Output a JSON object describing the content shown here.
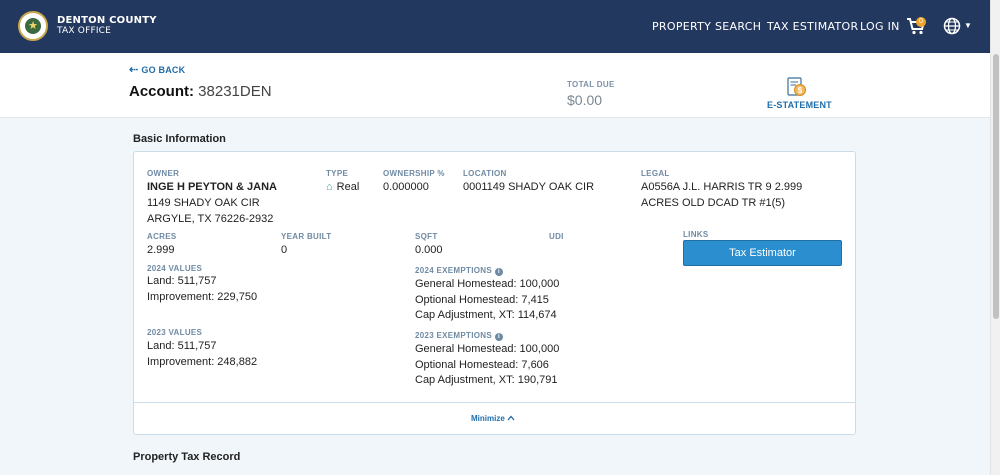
{
  "nav": {
    "brand_line1": "DENTON COUNTY",
    "brand_line2": "TAX OFFICE",
    "links": [
      "PROPERTY SEARCH",
      "TAX ESTIMATOR",
      "LOG IN"
    ],
    "cart_count": "0",
    "cart_icon": "cart-icon",
    "globe_icon": "globe-icon",
    "color": "#23385f"
  },
  "account": {
    "go_back": "GO BACK",
    "label": "Account:",
    "number": "38231DEN",
    "total_due_label": "TOTAL DUE",
    "total_due_value": "$0.00",
    "estatement_label": "E-STATEMENT"
  },
  "basic": {
    "title": "Basic Information",
    "owner_label": "OWNER",
    "owner_name": "INGE H PEYTON & JANA",
    "owner_addr1": "1149 SHADY OAK CIR",
    "owner_addr2": "ARGYLE, TX 76226-2932",
    "type_label": "TYPE",
    "type_value": "Real",
    "ownership_label": "OWNERSHIP %",
    "ownership_value": "0.000000",
    "location_label": "LOCATION",
    "location_value": "0001149 SHADY OAK CIR",
    "legal_label": "LEGAL",
    "legal_line1": "A0556A J.L. HARRIS TR 9 2.999",
    "legal_line2": "ACRES OLD DCAD TR #1(5)",
    "acres_label": "ACRES",
    "acres_value": "2.999",
    "year_built_label": "YEAR BUILT",
    "year_built_value": "0",
    "sqft_label": "SQFT",
    "sqft_value": "0.000",
    "udi_label": "UDI",
    "links_label": "LINKS",
    "tax_estimator_button": "Tax Estimator",
    "values_2024_label": "2024 VALUES",
    "values_2024": [
      "Land: 511,757",
      "Improvement: 229,750"
    ],
    "values_2023_label": "2023 VALUES",
    "values_2023": [
      "Land: 511,757",
      "Improvement: 248,882"
    ],
    "exemptions_2024_label": "2024 EXEMPTIONS",
    "exemptions_2024": [
      "General Homestead: 100,000",
      "Optional Homestead: 7,415",
      "Cap Adjustment, XT: 114,674"
    ],
    "exemptions_2023_label": "2023 EXEMPTIONS",
    "exemptions_2023": [
      "General Homestead: 100,000",
      "Optional Homestead: 7,606",
      "Cap Adjustment, XT: 190,791"
    ],
    "minimize": "Minimize"
  },
  "record": {
    "title": "Property Tax Record"
  }
}
